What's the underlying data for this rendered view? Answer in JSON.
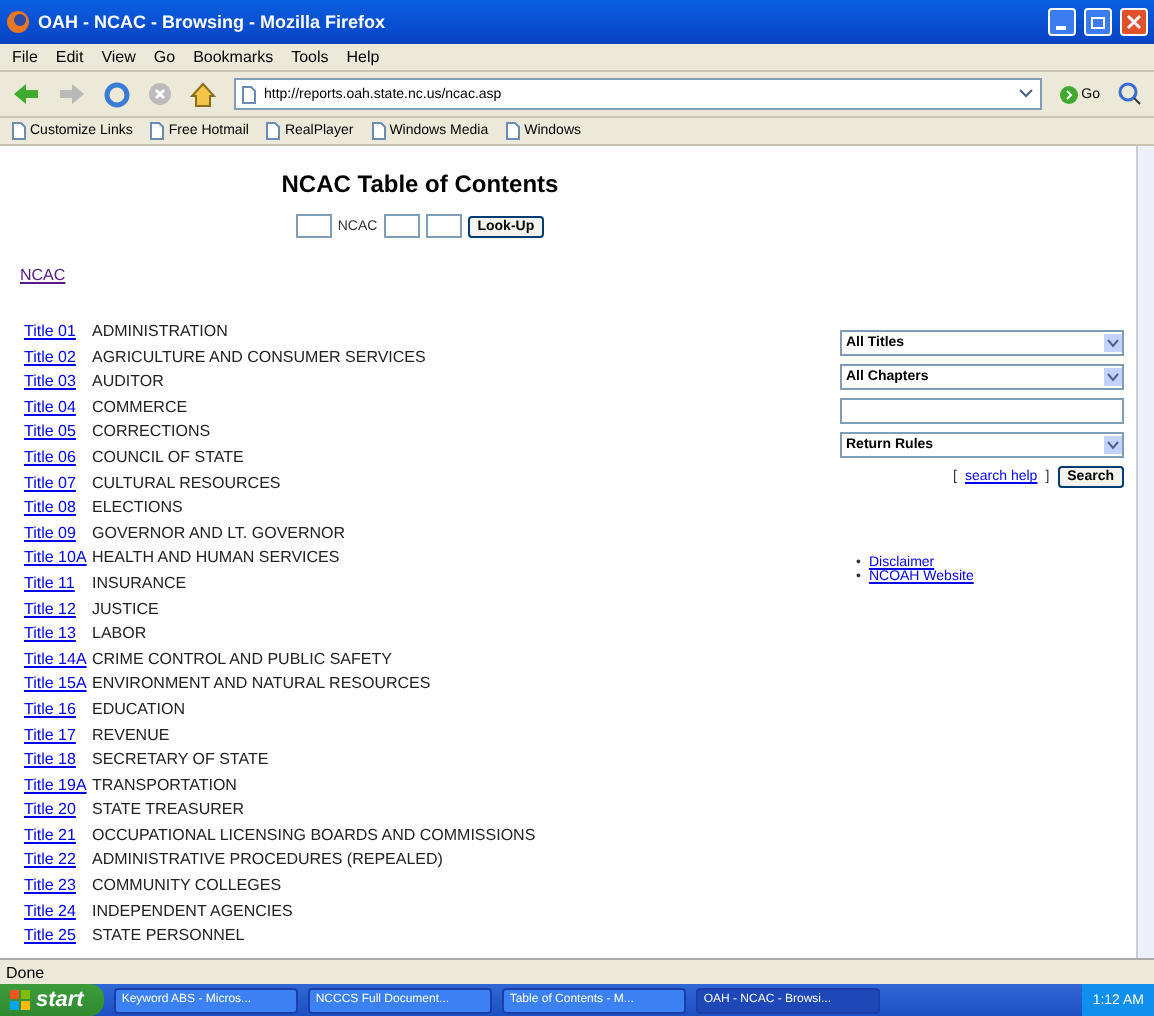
{
  "window": {
    "title": "OAH - NCAC - Browsing - Mozilla Firefox"
  },
  "menu": [
    "File",
    "Edit",
    "View",
    "Go",
    "Bookmarks",
    "Tools",
    "Help"
  ],
  "address": {
    "value": "http://reports.oah.state.nc.us/ncac.asp",
    "go": "Go"
  },
  "bookmarks": [
    "Customize Links",
    "Free Hotmail",
    "RealPlayer",
    "Windows Media",
    "Windows"
  ],
  "page": {
    "heading": "NCAC Table of Contents",
    "lookup": {
      "label": "NCAC",
      "button": "Look-Up"
    },
    "breadcrumb": "NCAC",
    "titles": [
      {
        "number": "Title 01",
        "name": "ADMINISTRATION"
      },
      {
        "number": "Title 02",
        "name": "AGRICULTURE AND CONSUMER SERVICES"
      },
      {
        "number": "Title 03",
        "name": "AUDITOR"
      },
      {
        "number": "Title 04",
        "name": "COMMERCE"
      },
      {
        "number": "Title 05",
        "name": "CORRECTIONS"
      },
      {
        "number": "Title 06",
        "name": "COUNCIL OF STATE"
      },
      {
        "number": "Title 07",
        "name": "CULTURAL RESOURCES"
      },
      {
        "number": "Title 08",
        "name": "ELECTIONS"
      },
      {
        "number": "Title 09",
        "name": "GOVERNOR AND LT. GOVERNOR"
      },
      {
        "number": "Title 10A",
        "name": "HEALTH AND HUMAN SERVICES"
      },
      {
        "number": "Title 11",
        "name": "INSURANCE"
      },
      {
        "number": "Title 12",
        "name": "JUSTICE"
      },
      {
        "number": "Title 13",
        "name": "LABOR"
      },
      {
        "number": "Title 14A",
        "name": "CRIME CONTROL AND PUBLIC SAFETY"
      },
      {
        "number": "Title 15A",
        "name": "ENVIRONMENT AND NATURAL RESOURCES"
      },
      {
        "number": "Title 16",
        "name": "EDUCATION"
      },
      {
        "number": "Title 17",
        "name": "REVENUE"
      },
      {
        "number": "Title 18",
        "name": "SECRETARY OF STATE"
      },
      {
        "number": "Title 19A",
        "name": "TRANSPORTATION"
      },
      {
        "number": "Title 20",
        "name": "STATE TREASURER"
      },
      {
        "number": "Title 21",
        "name": "OCCUPATIONAL LICENSING BOARDS AND COMMISSIONS"
      },
      {
        "number": "Title 22",
        "name": "ADMINISTRATIVE PROCEDURES (REPEALED)"
      },
      {
        "number": "Title 23",
        "name": "COMMUNITY COLLEGES"
      },
      {
        "number": "Title 24",
        "name": "INDEPENDENT AGENCIES"
      },
      {
        "number": "Title 25",
        "name": "STATE PERSONNEL"
      }
    ],
    "search": {
      "selects": [
        "All Titles",
        "All Chapters"
      ],
      "return": "Return Rules",
      "help_open": "[",
      "help": "search help",
      "help_close": "]",
      "button": "Search"
    },
    "links": [
      {
        "bullet": "•",
        "label": "Disclaimer"
      },
      {
        "bullet": "•",
        "label": "NCOAH Website"
      }
    ]
  },
  "status": "Done",
  "taskbar": {
    "start": "start",
    "items": [
      "Keyword ABS - Micros...",
      "NCCCS Full Document...",
      "Table of Contents - M...",
      "OAH - NCAC - Browsi..."
    ],
    "clock": "1:12 AM"
  }
}
